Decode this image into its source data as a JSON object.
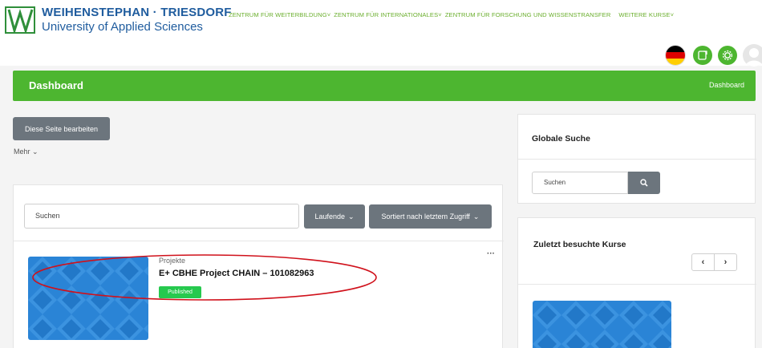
{
  "header": {
    "logo_title": "WEIHENSTEPHAN · TRIESDORF",
    "logo_subtitle": "University of Applied Sciences",
    "nav": [
      {
        "label": "ZENTRUM FÜR WEITERBILDUNG"
      },
      {
        "label": "ZENTRUM FÜR INTERNATIONALES"
      },
      {
        "label": "ZENTRUM FÜR FORSCHUNG UND WISSENSTRANSFER"
      },
      {
        "label": "WEITERE KURSE"
      }
    ],
    "icons": [
      "german-flag-icon",
      "notepad-icon",
      "gear-icon",
      "user-avatar-icon"
    ]
  },
  "banner": {
    "title": "Dashboard",
    "breadcrumb": "Dashboard"
  },
  "actions": {
    "edit_label": "Diese Seite bearbeiten",
    "more_label": "Mehr"
  },
  "courses": {
    "search_placeholder": "Suchen",
    "filter_label": "Laufende",
    "sort_label": "Sortiert nach letztem Zugriff",
    "items": [
      {
        "category": "Projekte",
        "title": "E+ CBHE Project CHAIN – 101082963",
        "status": "Published"
      }
    ]
  },
  "sidebar": {
    "global_search_title": "Globale Suche",
    "global_search_placeholder": "Suchen",
    "recent_title": "Zuletzt besuchte Kurse"
  },
  "colors": {
    "brand_green": "#4db630",
    "brand_blue": "#1f5c9e",
    "nav_green": "#6aae2c",
    "button_gray": "#6c757d",
    "published_green": "#26c94e",
    "annotation_red": "#d0111b",
    "course_blue": "#2a84d6"
  }
}
